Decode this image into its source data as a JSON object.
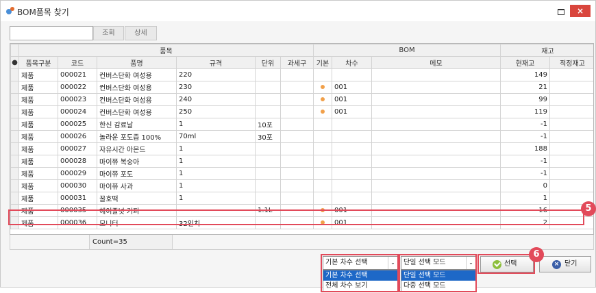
{
  "window": {
    "title": "BOM품목 찾기",
    "close_glyph": "×"
  },
  "toolbar": {
    "search_value": "",
    "search_button": "조회",
    "detail_button": "상세"
  },
  "grid": {
    "group_headers": {
      "item": "품목",
      "bom": "BOM",
      "stock": "재고"
    },
    "columns": {
      "indicator": "●",
      "category": "품목구분",
      "code": "코드",
      "name": "품명",
      "spec": "규격",
      "unit": "단위",
      "tax_group": "과세구",
      "base": "기본",
      "version": "차수",
      "memo": "메모",
      "current_stock": "현재고",
      "safety_stock": "적정재고"
    },
    "rows": [
      {
        "category": "제품",
        "code": "000021",
        "name": "컨버스단화 여성용",
        "spec": "220",
        "unit": "",
        "tax": "",
        "base": false,
        "version": "",
        "memo": "",
        "stock": "149",
        "safety": ""
      },
      {
        "category": "제품",
        "code": "000022",
        "name": "컨버스단화 여성용",
        "spec": "230",
        "unit": "",
        "tax": "",
        "base": true,
        "version": "001",
        "memo": "",
        "stock": "21",
        "safety": ""
      },
      {
        "category": "제품",
        "code": "000023",
        "name": "컨버스단화 여성용",
        "spec": "240",
        "unit": "",
        "tax": "",
        "base": true,
        "version": "001",
        "memo": "",
        "stock": "99",
        "safety": ""
      },
      {
        "category": "제품",
        "code": "000024",
        "name": "컨버스단화 여성용",
        "spec": "250",
        "unit": "",
        "tax": "",
        "base": true,
        "version": "001",
        "memo": "",
        "stock": "119",
        "safety": ""
      },
      {
        "category": "제품",
        "code": "000025",
        "name": "한신 감료날",
        "spec": "1",
        "unit": "10포",
        "tax": "",
        "base": false,
        "version": "",
        "memo": "",
        "stock": "-1",
        "safety": ""
      },
      {
        "category": "제품",
        "code": "000026",
        "name": "놀라운 포도즙 100%",
        "spec": "70ml",
        "unit": "30포",
        "tax": "",
        "base": false,
        "version": "",
        "memo": "",
        "stock": "-1",
        "safety": ""
      },
      {
        "category": "제품",
        "code": "000027",
        "name": "자유시간 아몬드",
        "spec": "1",
        "unit": "",
        "tax": "",
        "base": false,
        "version": "",
        "memo": "",
        "stock": "188",
        "safety": ""
      },
      {
        "category": "제품",
        "code": "000028",
        "name": "마이쮸 복숭아",
        "spec": "1",
        "unit": "",
        "tax": "",
        "base": false,
        "version": "",
        "memo": "",
        "stock": "-1",
        "safety": ""
      },
      {
        "category": "제품",
        "code": "000029",
        "name": "마이쮸 포도",
        "spec": "1",
        "unit": "",
        "tax": "",
        "base": false,
        "version": "",
        "memo": "",
        "stock": "-1",
        "safety": ""
      },
      {
        "category": "제품",
        "code": "000030",
        "name": "마이쮸 사과",
        "spec": "1",
        "unit": "",
        "tax": "",
        "base": false,
        "version": "",
        "memo": "",
        "stock": "0",
        "safety": ""
      },
      {
        "category": "제품",
        "code": "000031",
        "name": "꿀호떡",
        "spec": "1",
        "unit": "",
        "tax": "",
        "base": false,
        "version": "",
        "memo": "",
        "stock": "1",
        "safety": ""
      },
      {
        "category": "제품",
        "code": "000035",
        "name": "헤이즐넛 커피",
        "spec": "",
        "unit": "1.1L",
        "tax": "",
        "base": true,
        "version": "001",
        "memo": "",
        "stock": "-16",
        "safety": ""
      },
      {
        "category": "제품",
        "code": "000036",
        "name": "모니터",
        "spec": "32인치",
        "unit": "",
        "tax": "",
        "base": true,
        "version": "001",
        "memo": "",
        "stock": "2",
        "safety": ""
      }
    ],
    "count_text": "Count=35"
  },
  "bottom": {
    "version_select": {
      "value": "기본 차수 선택",
      "options": [
        "기본 차수 선택",
        "전체 차수 보기"
      ],
      "arrow": "⌄"
    },
    "mode_select": {
      "value": "단일 선택 모드",
      "options": [
        "단일 선택 모드",
        "다중 선택 모드"
      ],
      "arrow": "⌄"
    },
    "select_button": "선택",
    "close_button": "닫기"
  },
  "annotations": {
    "badge_5": "5",
    "badge_6": "6"
  },
  "colors": {
    "highlight_red": "#e24a5a",
    "selection_blue": "#1e68c7",
    "close_red": "#d9453c",
    "base_dot": "#f1a04a"
  }
}
